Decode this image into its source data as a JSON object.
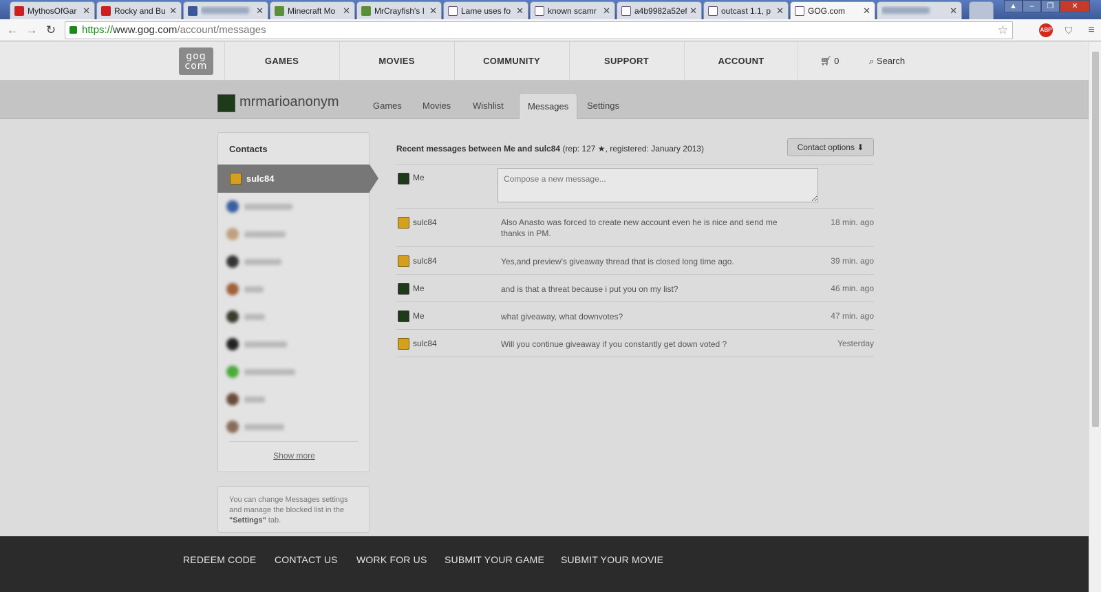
{
  "browser": {
    "tabs": [
      {
        "label": "MythosOfGar",
        "fav": "yt",
        "left": 0
      },
      {
        "label": "Rocky and Bu",
        "fav": "yt"
      },
      {
        "label": "",
        "fav": "fb",
        "blurred": true
      },
      {
        "label": "Minecraft Mo",
        "fav": "mc"
      },
      {
        "label": "MrCrayfish's I",
        "fav": "mc"
      },
      {
        "label": "Lame uses fo",
        "fav": "gog"
      },
      {
        "label": "known scamr",
        "fav": "gog"
      },
      {
        "label": "a4b9982a52ef",
        "fav": "gog"
      },
      {
        "label": "outcast 1.1, p",
        "fav": "gog"
      },
      {
        "label": "GOG.com",
        "fav": "gog",
        "active": true
      },
      {
        "label": "",
        "fav": "none",
        "blurred": true
      }
    ],
    "url_scheme": "https://",
    "url_host": "www.gog.com",
    "url_path": "/account/messages",
    "abp_label": "ABP"
  },
  "nav": {
    "logo_top": "gog",
    "logo_bottom": "com",
    "items": [
      "GAMES",
      "MOVIES",
      "COMMUNITY",
      "SUPPORT",
      "ACCOUNT"
    ],
    "cart_count": "0",
    "search_label": "Search"
  },
  "account": {
    "username": "mrmarioanonym",
    "tabs": [
      "Games",
      "Movies",
      "Wishlist",
      "Messages",
      "Settings"
    ],
    "active_tab": "Messages"
  },
  "contacts": {
    "title": "Contacts",
    "active_contact": "sulc84",
    "show_more": "Show more",
    "settings_note_before": "You can change Messages settings and manage the blocked list in the ",
    "settings_note_bold": "\"Settings\"",
    "settings_note_after": " tab."
  },
  "messages": {
    "header_bold": "Recent messages between Me and sulc84",
    "header_rest": " (rep: 127 ★, registered: January 2013)",
    "contact_options": "Contact options",
    "me_label": "Me",
    "compose_placeholder": "Compose a new message...",
    "rows": [
      {
        "sender": "sulc84",
        "text": "Also Anasto was forced to create new account even he is nice and send me thanks in PM.",
        "time": "18 min. ago"
      },
      {
        "sender": "sulc84",
        "text": "Yes,and preview's giveaway thread that is closed long time ago.",
        "time": "39 min. ago"
      },
      {
        "sender": "Me",
        "text": "and is that a threat because i put you on my list?",
        "time": "46 min. ago"
      },
      {
        "sender": "Me",
        "text": "what giveaway, what downvotes?",
        "time": "47 min. ago"
      },
      {
        "sender": "sulc84",
        "text": "Will you continue giveaway if you constantly get down voted ?",
        "time": "Yesterday"
      }
    ]
  },
  "footer": {
    "links": [
      "REDEEM CODE",
      "CONTACT US",
      "WORK FOR US",
      "SUBMIT YOUR GAME",
      "SUBMIT YOUR MOVIE"
    ]
  }
}
